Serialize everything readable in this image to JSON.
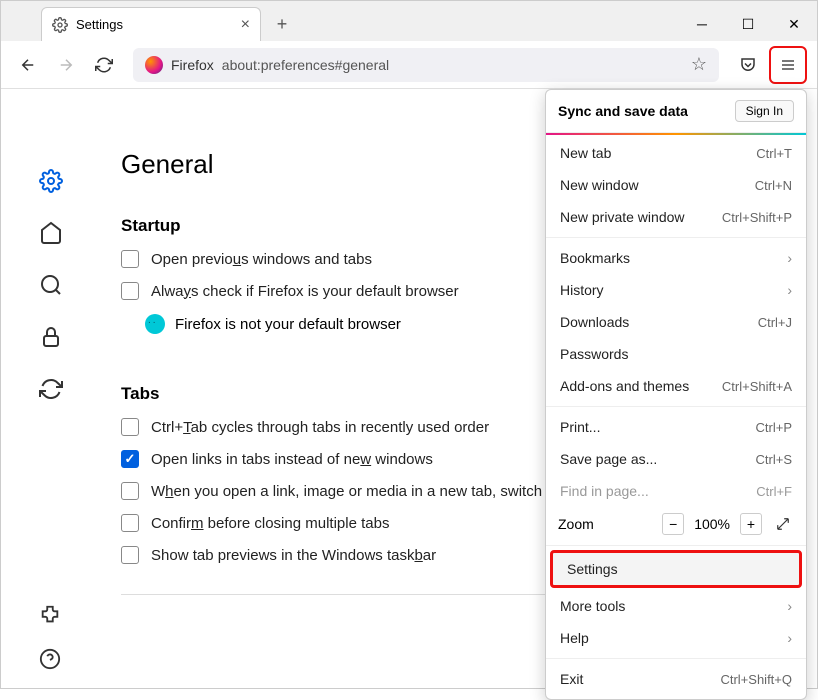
{
  "tab": {
    "title": "Settings"
  },
  "urlbar": {
    "brand": "Firefox",
    "url": "about:preferences#general"
  },
  "page": {
    "title": "General",
    "startup": {
      "heading": "Startup",
      "open_prev": "Open previous windows and tabs",
      "always_check": "Always check if Firefox is your default browser",
      "not_default": "Firefox is not your default browser"
    },
    "tabs": {
      "heading": "Tabs",
      "ctrl_tab": "Ctrl+Tab cycles through tabs in recently used order",
      "open_links": "Open links in tabs instead of new windows",
      "switch_to": "When you open a link, image or media in a new tab, switch to it immediately",
      "confirm": "Confirm before closing multiple tabs",
      "taskbar": "Show tab previews in the Windows taskbar"
    }
  },
  "menu": {
    "sync_label": "Sync and save data",
    "signin": "Sign In",
    "new_tab": {
      "label": "New tab",
      "sc": "Ctrl+T"
    },
    "new_window": {
      "label": "New window",
      "sc": "Ctrl+N"
    },
    "new_private": {
      "label": "New private window",
      "sc": "Ctrl+Shift+P"
    },
    "bookmarks": "Bookmarks",
    "history": "History",
    "downloads": {
      "label": "Downloads",
      "sc": "Ctrl+J"
    },
    "passwords": "Passwords",
    "addons": {
      "label": "Add-ons and themes",
      "sc": "Ctrl+Shift+A"
    },
    "print": {
      "label": "Print...",
      "sc": "Ctrl+P"
    },
    "save_as": {
      "label": "Save page as...",
      "sc": "Ctrl+S"
    },
    "find": {
      "label": "Find in page...",
      "sc": "Ctrl+F"
    },
    "zoom": {
      "label": "Zoom",
      "value": "100%"
    },
    "settings": "Settings",
    "more_tools": "More tools",
    "help": "Help",
    "exit": {
      "label": "Exit",
      "sc": "Ctrl+Shift+Q"
    }
  }
}
